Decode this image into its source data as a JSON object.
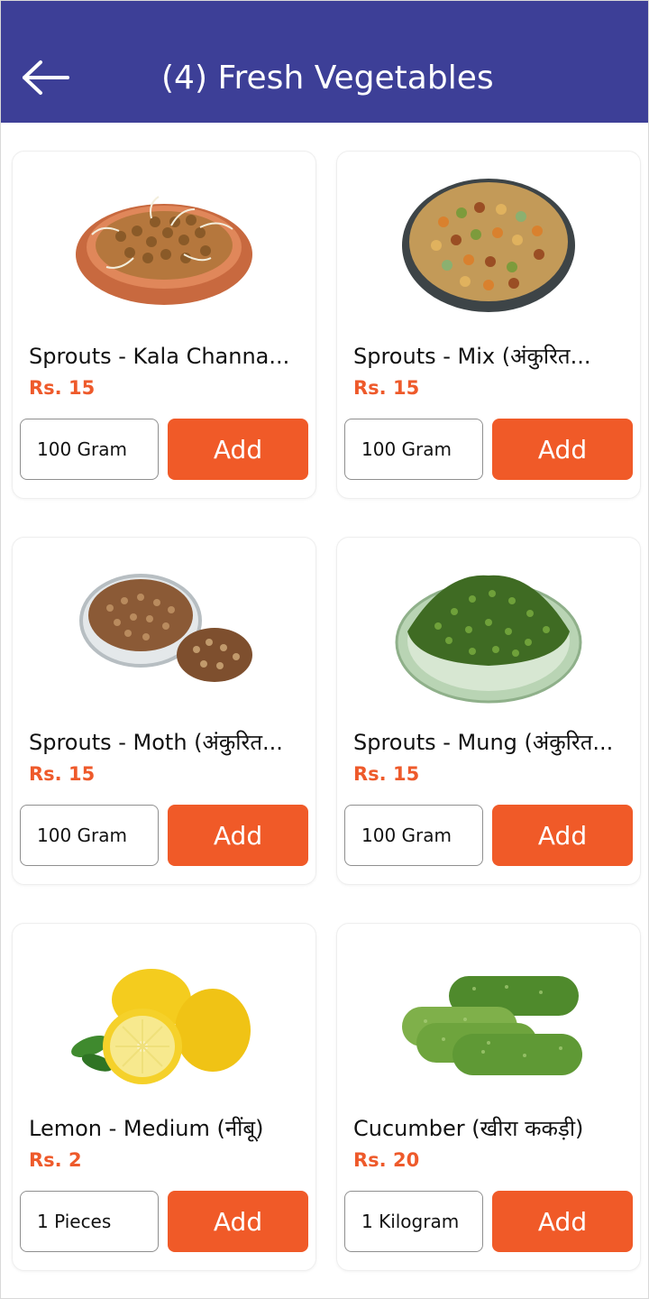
{
  "header": {
    "title": "(4) Fresh Vegetables",
    "back_icon": "arrow-left-icon",
    "background": "#3d3f97"
  },
  "accent_color": "#f05a28",
  "products": [
    {
      "name": "Sprouts - Kala Channa...",
      "price": "Rs. 15",
      "quantity": "100 Gram",
      "add_label": "Add"
    },
    {
      "name": "Sprouts - Mix (अंकुरित...",
      "price": "Rs. 15",
      "quantity": "100 Gram",
      "add_label": "Add"
    },
    {
      "name": "Sprouts - Moth (अंकुरित...",
      "price": "Rs. 15",
      "quantity": "100 Gram",
      "add_label": "Add"
    },
    {
      "name": "Sprouts - Mung (अंकुरित...",
      "price": "Rs. 15",
      "quantity": "100 Gram",
      "add_label": "Add"
    },
    {
      "name": "Lemon - Medium  (नींबू)",
      "price": "Rs. 2",
      "quantity": "1 Pieces",
      "add_label": "Add"
    },
    {
      "name": "Cucumber  (खीरा ककड़ी)",
      "price": "Rs. 20",
      "quantity": "1 Kilogram",
      "add_label": "Add"
    }
  ]
}
